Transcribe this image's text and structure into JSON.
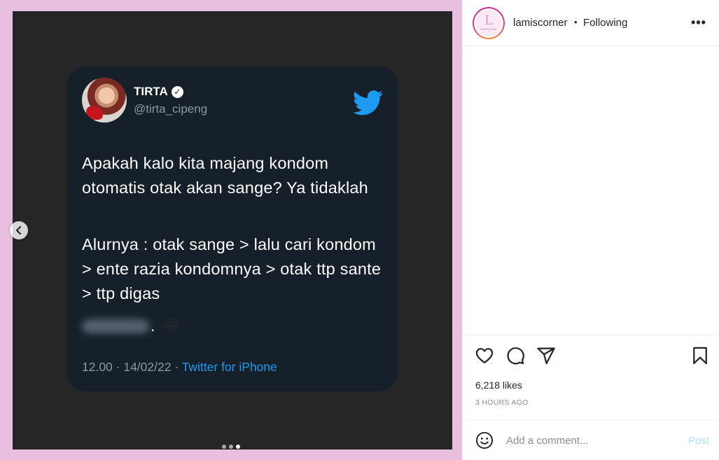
{
  "post": {
    "carousel": {
      "slide_count": 3,
      "active_slide": 3
    },
    "tweet": {
      "name": "TIRTA",
      "verified_symbol": "✓",
      "handle": "@tirta_cipeng",
      "paragraph_1": "Apakah kalo kita majang kondom otomatis otak akan sange? Ya tidaklah",
      "paragraph_2": "Alurnya : otak sange > lalu cari kondom > ente razia kondomnya > otak ttp sante > ttp digas",
      "blur_suffix": ".",
      "emoji": "😂",
      "meta_prefix": "12.00 · 14/02/22 · ",
      "source": "Twitter for iPhone",
      "icons": {
        "brand": "twitter-bird-icon",
        "verified": "verified-badge-icon"
      },
      "colors": {
        "card": "#15202b",
        "text": "#ffffff",
        "muted": "#8b98a5",
        "link": "#1d9bf0"
      }
    }
  },
  "side": {
    "header": {
      "avatar_letter": "L",
      "avatar_caption": "lamiscorner",
      "username": "lamiscorner",
      "separator": "•",
      "follow_status": "Following",
      "more": "•••"
    },
    "actions": {
      "icons": [
        "heart-icon",
        "comment-icon",
        "share-icon",
        "bookmark-icon"
      ],
      "likes": "6,218 likes",
      "time_ago": "3 HOURS AGO"
    },
    "comment": {
      "placeholder": "Add a comment...",
      "post_label": "Post"
    }
  },
  "colors": {
    "frame": "#e9bfe0",
    "media_bg": "#262626",
    "post_button_disabled": "#b2dffc"
  }
}
